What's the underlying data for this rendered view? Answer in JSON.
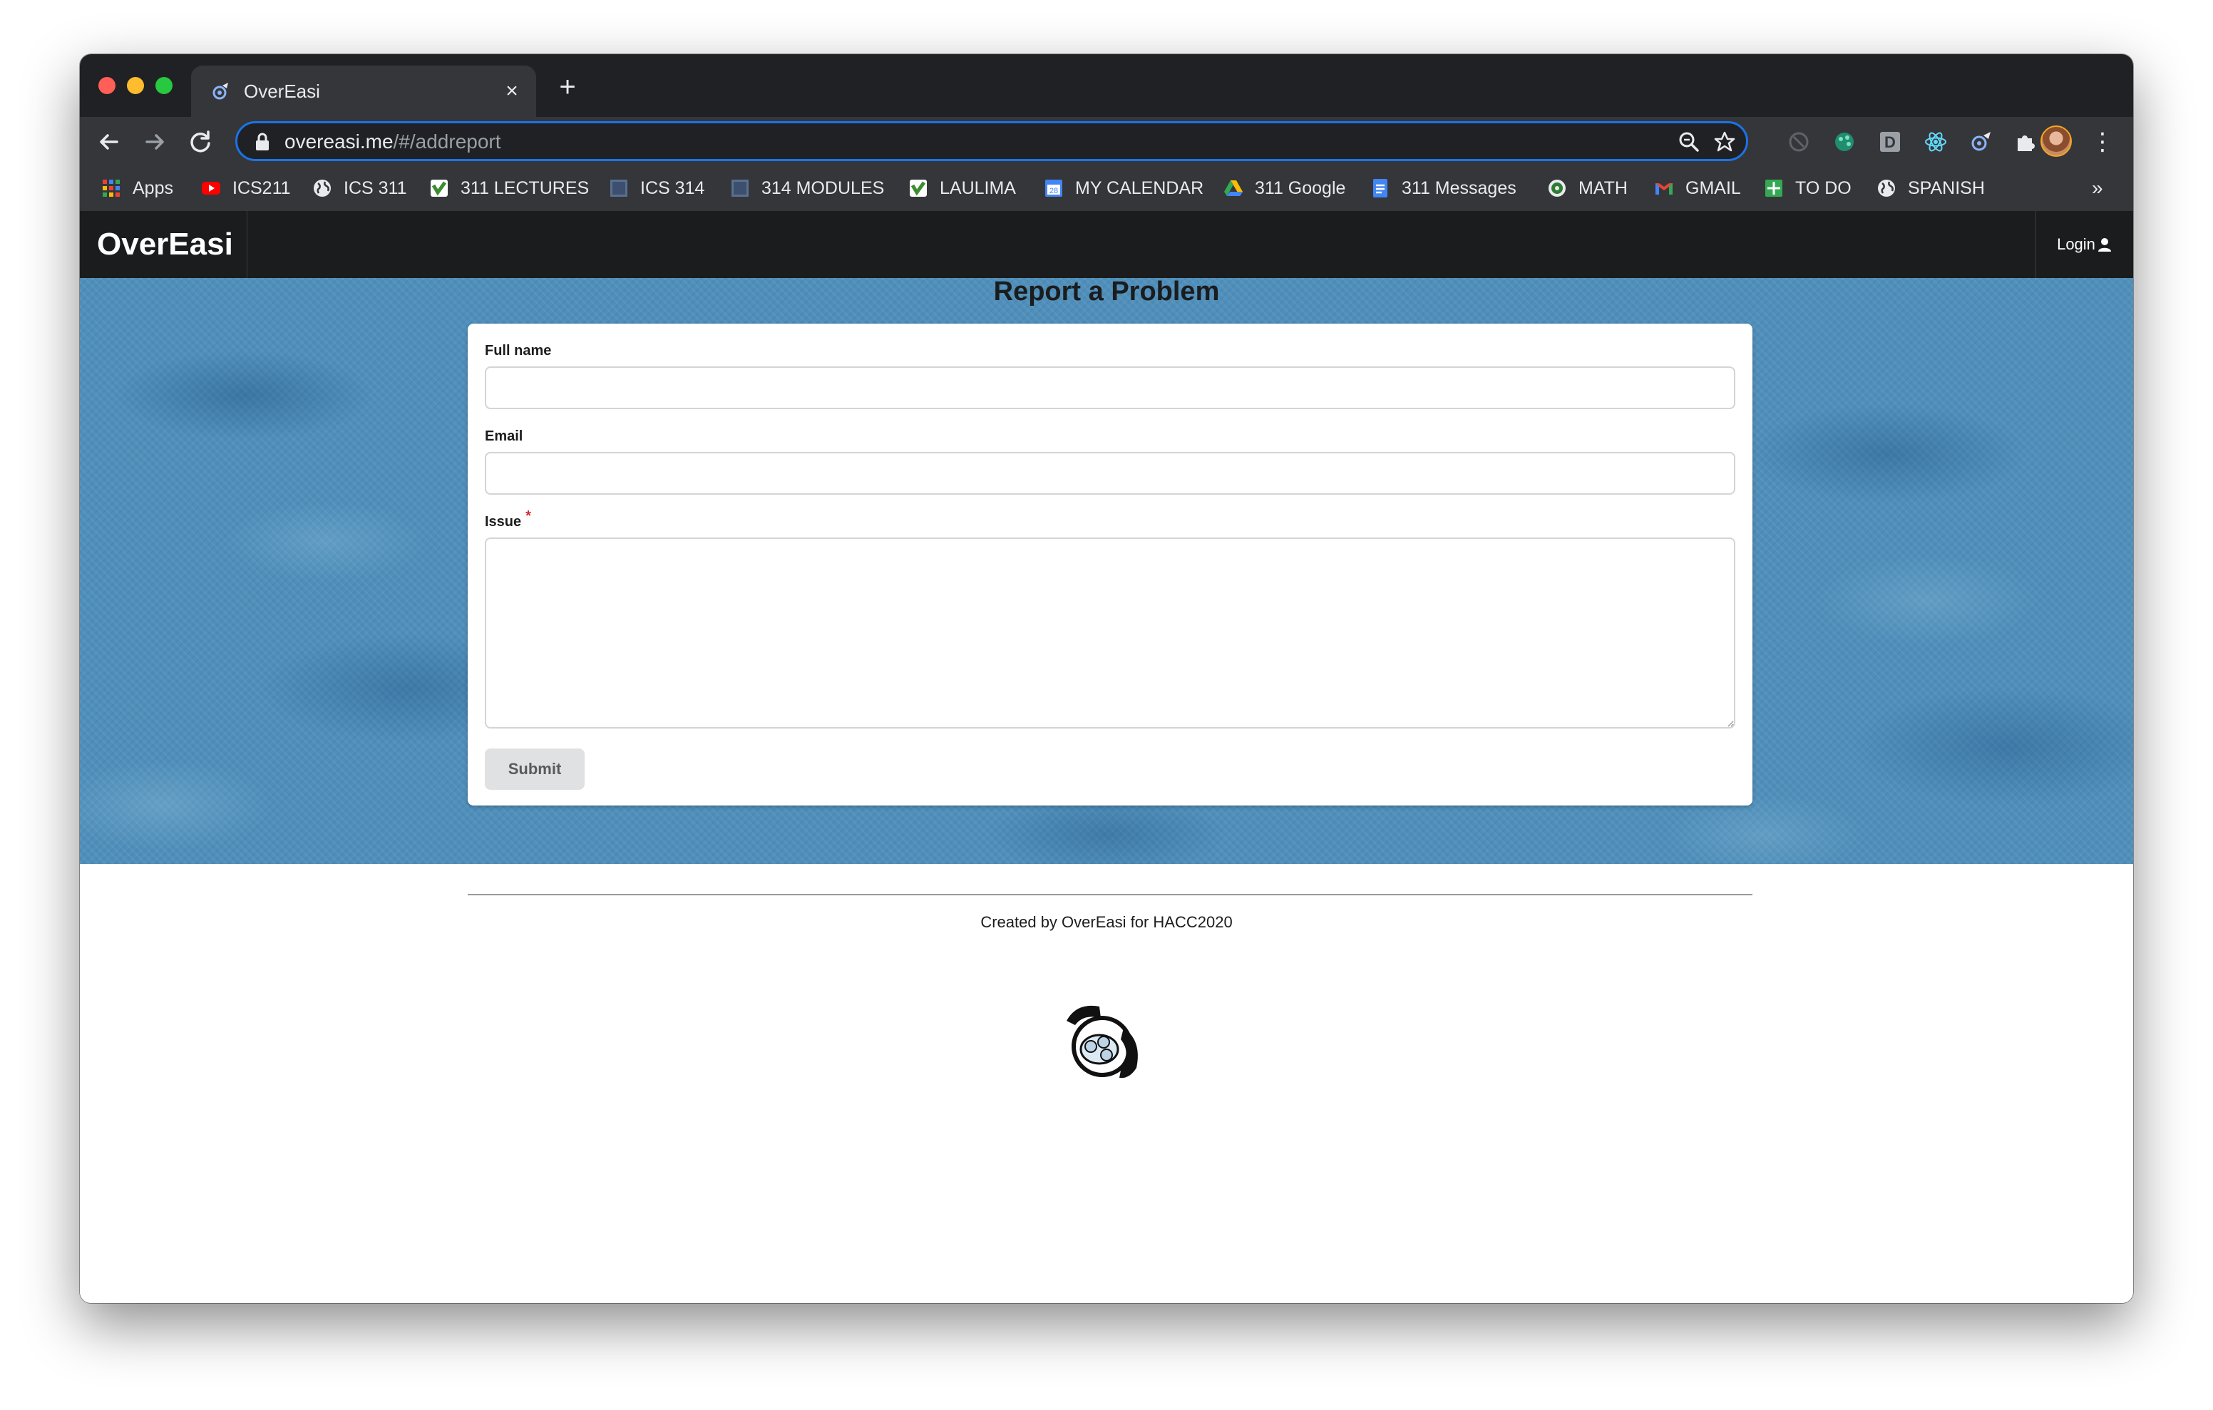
{
  "browser": {
    "tab_title": "OverEasi",
    "tab_close": "×",
    "new_tab": "+",
    "url_host": "overeasi.me",
    "url_path": "/#/addreport",
    "more_menu": "⋮"
  },
  "bookmarks": {
    "items": [
      {
        "label": "Apps",
        "icon": "apps-grid-icon"
      },
      {
        "label": "ICS211",
        "icon": "youtube-icon"
      },
      {
        "label": "ICS 311",
        "icon": "globe-icon"
      },
      {
        "label": "311 LECTURES",
        "icon": "laulima-icon"
      },
      {
        "label": "ICS 314",
        "icon": "square-icon"
      },
      {
        "label": "314 MODULES",
        "icon": "square-icon"
      },
      {
        "label": "LAULIMA",
        "icon": "laulima-icon"
      },
      {
        "label": "MY CALENDAR",
        "icon": "calendar-icon",
        "badge": "28"
      },
      {
        "label": "311 Google",
        "icon": "google-drive-icon"
      },
      {
        "label": "311 Messages",
        "icon": "google-docs-icon"
      },
      {
        "label": "MATH",
        "icon": "math-icon"
      },
      {
        "label": "GMAIL",
        "icon": "gmail-icon"
      },
      {
        "label": "TO DO",
        "icon": "sheets-icon"
      },
      {
        "label": "SPANISH",
        "icon": "globe-icon"
      }
    ],
    "more": "»"
  },
  "navbar": {
    "brand": "OverEasi",
    "login": "Login"
  },
  "report": {
    "title": "Report a Problem",
    "full_name_label": "Full name",
    "full_name_value": "",
    "email_label": "Email",
    "email_value": "",
    "issue_label": "Issue",
    "issue_required": "*",
    "issue_value": "",
    "submit_label": "Submit"
  },
  "footer": {
    "credit": "Created by OverEasi for HACC2020"
  },
  "colors": {
    "navbar": "#1b1c1d",
    "hero": "#4f8fbb",
    "omnibox_focus": "#1a73e8",
    "required": "#db2828"
  }
}
